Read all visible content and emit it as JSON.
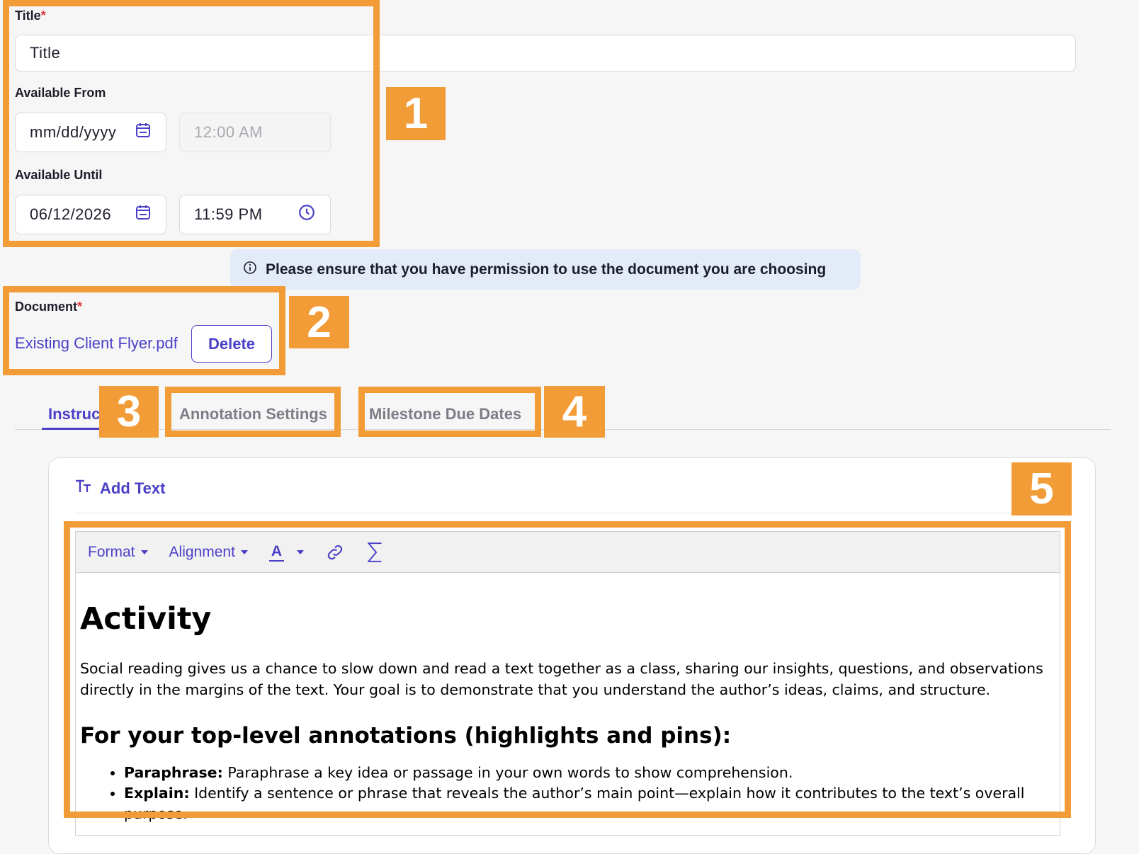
{
  "title_field": {
    "label": "Title",
    "required_mark": "*",
    "value": "Title"
  },
  "available_from": {
    "label": "Available From",
    "date_placeholder": "mm/dd/yyyy",
    "time_value": "12:00 AM"
  },
  "available_until": {
    "label": "Available Until",
    "date_value": "06/12/2026",
    "time_value": "11:59 PM"
  },
  "notice": {
    "text": "Please ensure that you have permission to use the document you are choosing"
  },
  "document": {
    "label": "Document",
    "required_mark": "*",
    "file_name": "Existing Client Flyer.pdf",
    "delete_label": "Delete"
  },
  "tabs": [
    {
      "label": "Instruc",
      "active": true
    },
    {
      "label": "Annotation Settings",
      "active": false
    },
    {
      "label": "Milestone Due Dates",
      "active": false
    }
  ],
  "editor": {
    "add_text_label": "Add Text",
    "toolbar": {
      "format": "Format",
      "alignment": "Alignment",
      "font_color": "A"
    },
    "content": {
      "heading": "Activity",
      "paragraph": "Social reading gives us a chance to slow down and read a text together as a class, sharing our insights, questions, and observations directly in the margins of the text. Your goal is to demonstrate that you understand the author’s ideas, claims, and structure.",
      "subheading": "For your top-level annotations (highlights and pins):",
      "bullets": [
        {
          "term": "Paraphrase:",
          "text": "Paraphrase a key idea or passage in your own words to show comprehension."
        },
        {
          "term": "Explain:",
          "text": "Identify a sentence or phrase that reveals the author’s main point—explain how it contributes to the text’s overall purpose."
        }
      ]
    }
  },
  "annotation_markers": [
    "1",
    "2",
    "3",
    "4",
    "5"
  ],
  "colors": {
    "accent": "#4b3fc7",
    "highlight": "#f29c38",
    "notice_bg": "#e3ebf8"
  }
}
